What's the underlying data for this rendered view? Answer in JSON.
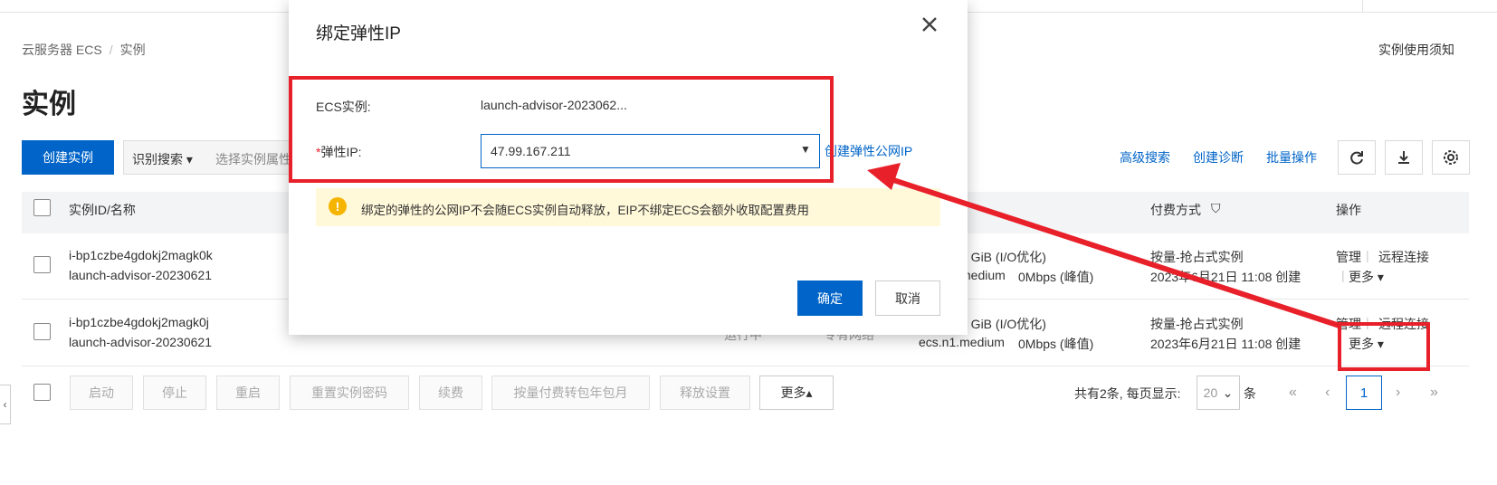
{
  "breadcrumb": {
    "root": "云服务器 ECS",
    "sep": "/",
    "current": "实例"
  },
  "header": {
    "notice_link": "实例使用须知",
    "page_title": "实例"
  },
  "toolbar": {
    "create_button": "创建实例",
    "search_type": "识别搜索",
    "search_placeholder": "选择实例属性",
    "advanced_search": "高级搜索",
    "create_diagnosis": "创建诊断",
    "batch_ops": "批量操作"
  },
  "table": {
    "columns": {
      "id_name": "实例ID/名称",
      "billing": "付费方式",
      "actions": "操作"
    },
    "rows": [
      {
        "id": "i-bp1czbe4gdokj2magk0k",
        "name": "launch-advisor-20230621",
        "spec_partial": "4 GiB   (I/O优化)",
        "spec_type_partial": "medium",
        "bandwidth": "0Mbps   (峰值)",
        "billing_type": "按量-抢占式实例",
        "created": "2023年6月21日 11:08 创建",
        "action_manage": "管理",
        "action_remote": "远程连接",
        "action_more": "更多"
      },
      {
        "id": "i-bp1czbe4gdokj2magk0j",
        "name": "launch-advisor-20230621",
        "spec_partial": "4 GiB   (I/O优化)",
        "spec_type_partial": "ecs.n1.medium",
        "bandwidth": "0Mbps   (峰值)",
        "billing_type": "按量-抢占式实例",
        "created": "2023年6月21日 11:08 创建",
        "action_manage": "管理",
        "action_remote": "远程连接",
        "action_more": "更多",
        "hidden_partial_1": "专有网络",
        "hidden_partial_2": "运行中"
      }
    ]
  },
  "bottom_bar": {
    "buttons": [
      "启动",
      "停止",
      "重启",
      "重置实例密码",
      "续费",
      "按量付费转包年包月",
      "释放设置"
    ],
    "more": "更多"
  },
  "pager": {
    "summary": "共有2条, 每页显示:",
    "page_size": "20",
    "unit": "条",
    "current_page": "1",
    "first": "«",
    "prev": "‹",
    "next": "›",
    "last": "»"
  },
  "modal": {
    "title": "绑定弹性IP",
    "ecs_label": "ECS实例:",
    "ecs_value": "launch-advisor-2023062...",
    "eip_required_mark": "*",
    "eip_label": "弹性IP:",
    "eip_value": "47.99.167.211",
    "create_eip_link": "创建弹性公网IP",
    "warning": "绑定的弹性的公网IP不会随ECS实例自动释放，EIP不绑定ECS会额外收取配置费用",
    "ok": "确定",
    "cancel": "取消"
  },
  "colors": {
    "primary": "#0064c8",
    "annotation": "#e8202a",
    "warning_bg": "#fff8d9",
    "warning_icon": "#f5b400"
  }
}
